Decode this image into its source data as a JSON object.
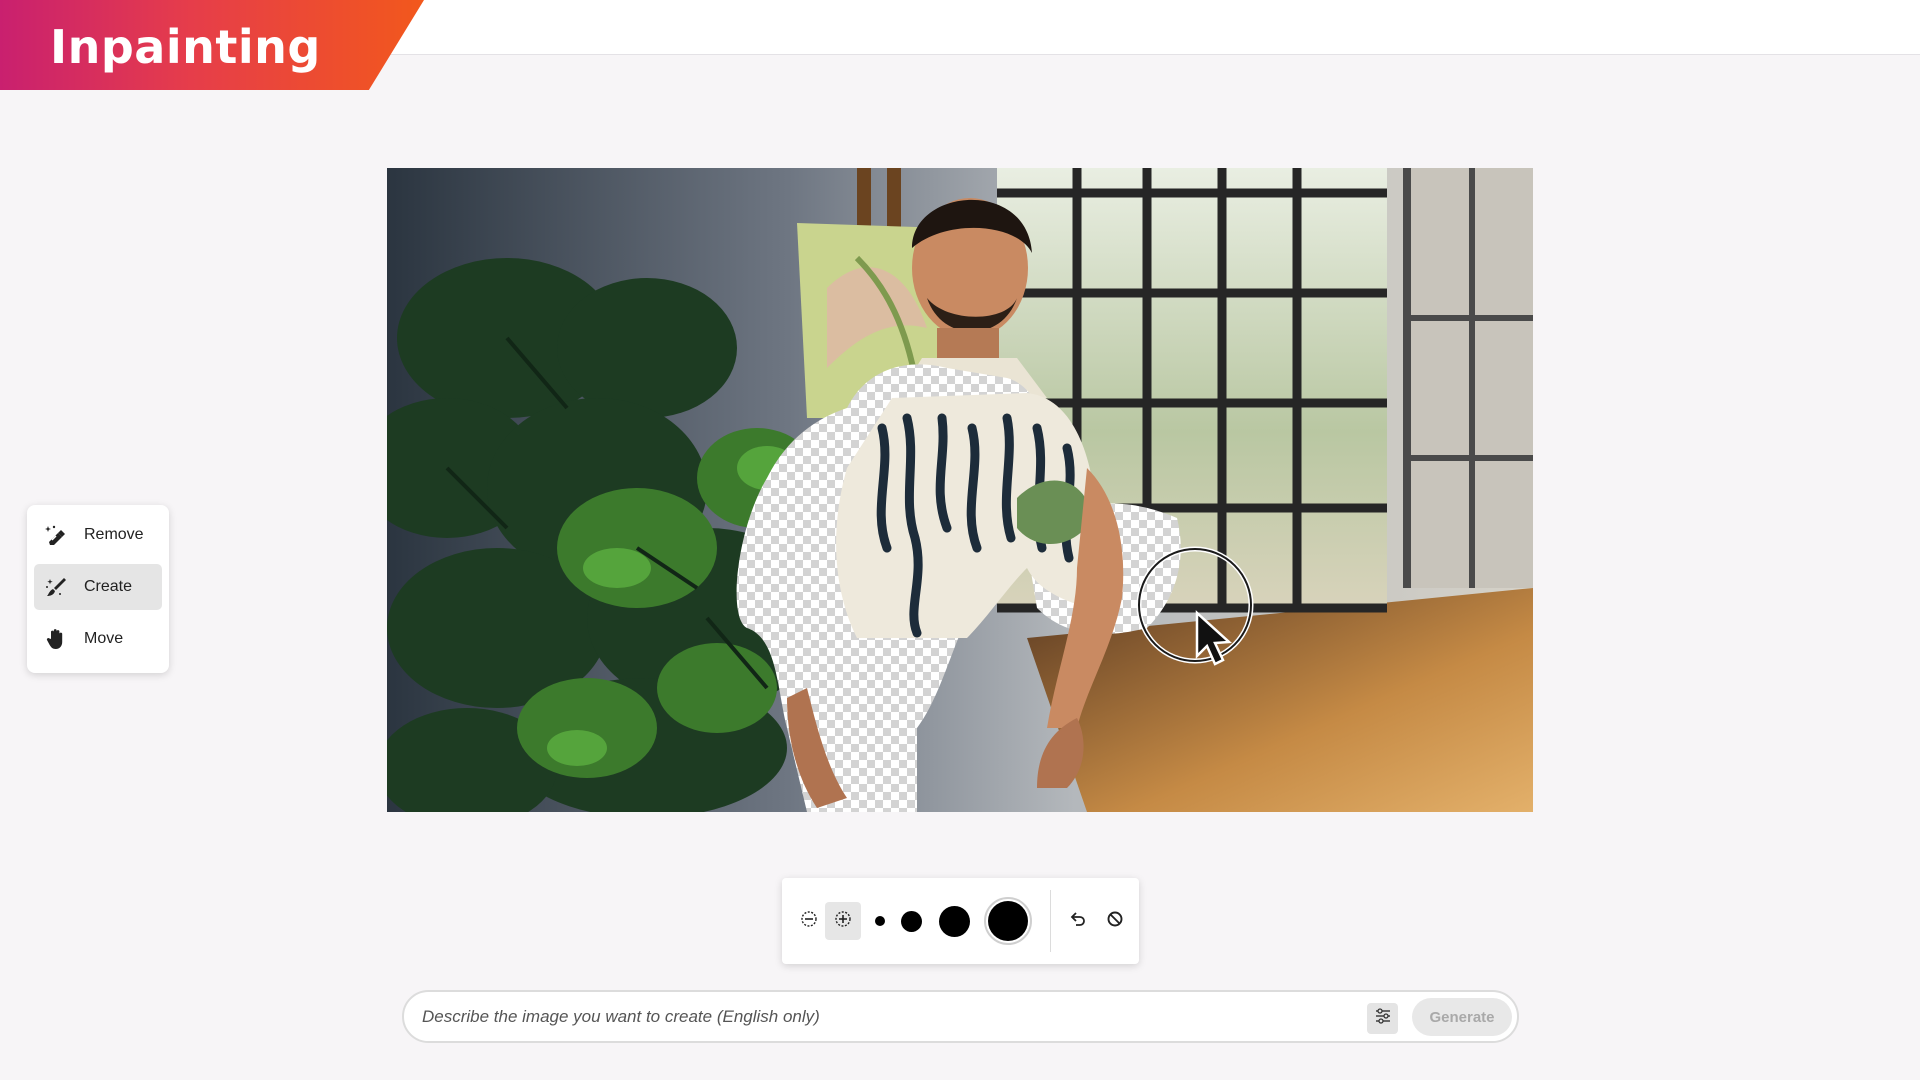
{
  "header": {
    "title": "Inpainting",
    "banner_gradient": [
      "#c9206f",
      "#e63d4a",
      "#f2581c"
    ]
  },
  "tools": {
    "items": [
      {
        "label": "Remove",
        "icon": "eraser-sparkle-icon",
        "active": false
      },
      {
        "label": "Create",
        "icon": "brush-sparkle-icon",
        "active": true
      },
      {
        "label": "Move",
        "icon": "hand-icon",
        "active": false
      }
    ]
  },
  "canvas": {
    "image": "man-in-shirt-with-monstera-plants-by-window",
    "mask": "transparency-checkerboard",
    "cursor": "brush-cursor-with-arrow"
  },
  "brush_toolbar": {
    "icons": [
      "subtract-icon",
      "add-icon",
      "brush-size-1",
      "brush-size-2",
      "brush-size-3",
      "brush-size-4",
      "undo-icon",
      "clear-icon"
    ],
    "selected_mode": "add"
  },
  "prompt": {
    "placeholder": "Describe the image you want to create (English only)",
    "value": "",
    "settings_icon": "sliders-icon",
    "generate_label": "Generate"
  }
}
